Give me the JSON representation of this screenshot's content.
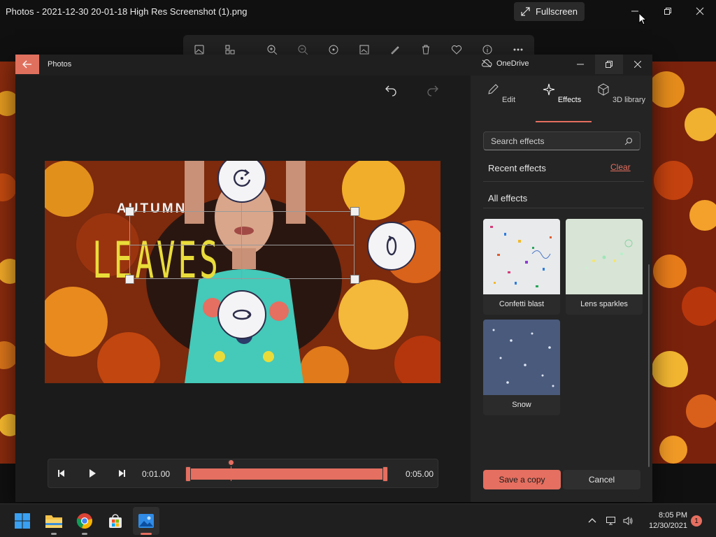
{
  "viewer": {
    "title": "Photos - 2021-12-30 20-01-18 High Res Screenshot (1).png",
    "fullscreen_label": "Fullscreen"
  },
  "editor": {
    "app_name": "Photos",
    "onedrive_label": "OneDrive"
  },
  "canvas": {
    "text_line_1": "AUTUMN",
    "text_line_2": "LEAVES"
  },
  "timeline": {
    "current_time": "0:01.00",
    "end_time": "0:05.00"
  },
  "panel": {
    "tabs": [
      {
        "label": "Edit",
        "icon": "pencil-icon"
      },
      {
        "label": "Effects",
        "icon": "sparkle-icon"
      },
      {
        "label": "3D library",
        "icon": "cube-icon"
      }
    ],
    "active_tab": "Effects",
    "search_placeholder": "Search effects",
    "recent_label": "Recent effects",
    "clear_label": "Clear",
    "all_label": "All effects",
    "effects": [
      {
        "label": "Confetti blast"
      },
      {
        "label": "Lens sparkles"
      },
      {
        "label": "Snow"
      }
    ],
    "save_label": "Save a copy",
    "cancel_label": "Cancel"
  },
  "taskbar": {
    "time": "8:05 PM",
    "date": "12/30/2021",
    "notification_count": "1"
  },
  "colors": {
    "accent": "#e56f60",
    "panel_bg": "#242424",
    "window_bg": "#1c1c1c",
    "title_yellow": "#e9dc3a"
  }
}
